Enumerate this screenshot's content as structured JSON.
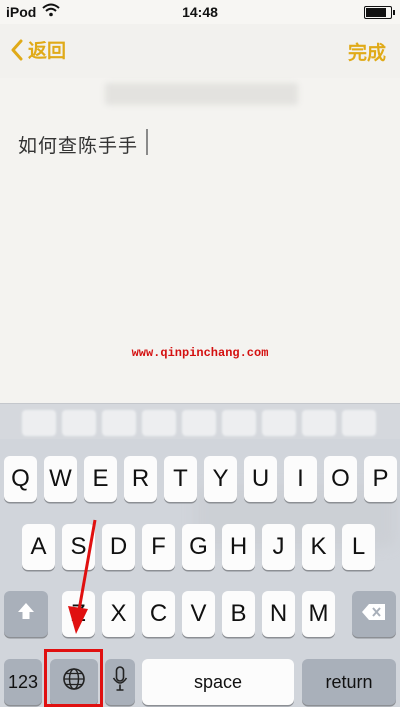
{
  "status_bar": {
    "carrier": "iPod",
    "time": "14:48",
    "wifi_icon": "wifi-icon",
    "battery_icon": "battery-icon"
  },
  "nav": {
    "back_label": "返回",
    "done_label": "完成"
  },
  "note": {
    "text": "如何查陈手手"
  },
  "watermark": "www.qinpinchang.com",
  "keyboard": {
    "row1": [
      "Q",
      "W",
      "E",
      "R",
      "T",
      "Y",
      "U",
      "I",
      "O",
      "P"
    ],
    "row2": [
      "A",
      "S",
      "D",
      "F",
      "G",
      "H",
      "J",
      "K",
      "L"
    ],
    "row3": [
      "Z",
      "X",
      "C",
      "V",
      "B",
      "N",
      "M"
    ],
    "numbers_label": "123",
    "space_label": "space",
    "return_label": "return",
    "shift_icon": "shift-icon",
    "delete_icon": "delete-icon",
    "globe_icon": "globe-icon",
    "mic_icon": "microphone-icon"
  },
  "annotation": {
    "color": "#e01010",
    "target": "globe-key"
  },
  "colors": {
    "accent": "#e0aa18",
    "keyboard_bg": "#d1d5db",
    "key": "#fcfcfc",
    "dark_key": "#a9b0ba"
  }
}
